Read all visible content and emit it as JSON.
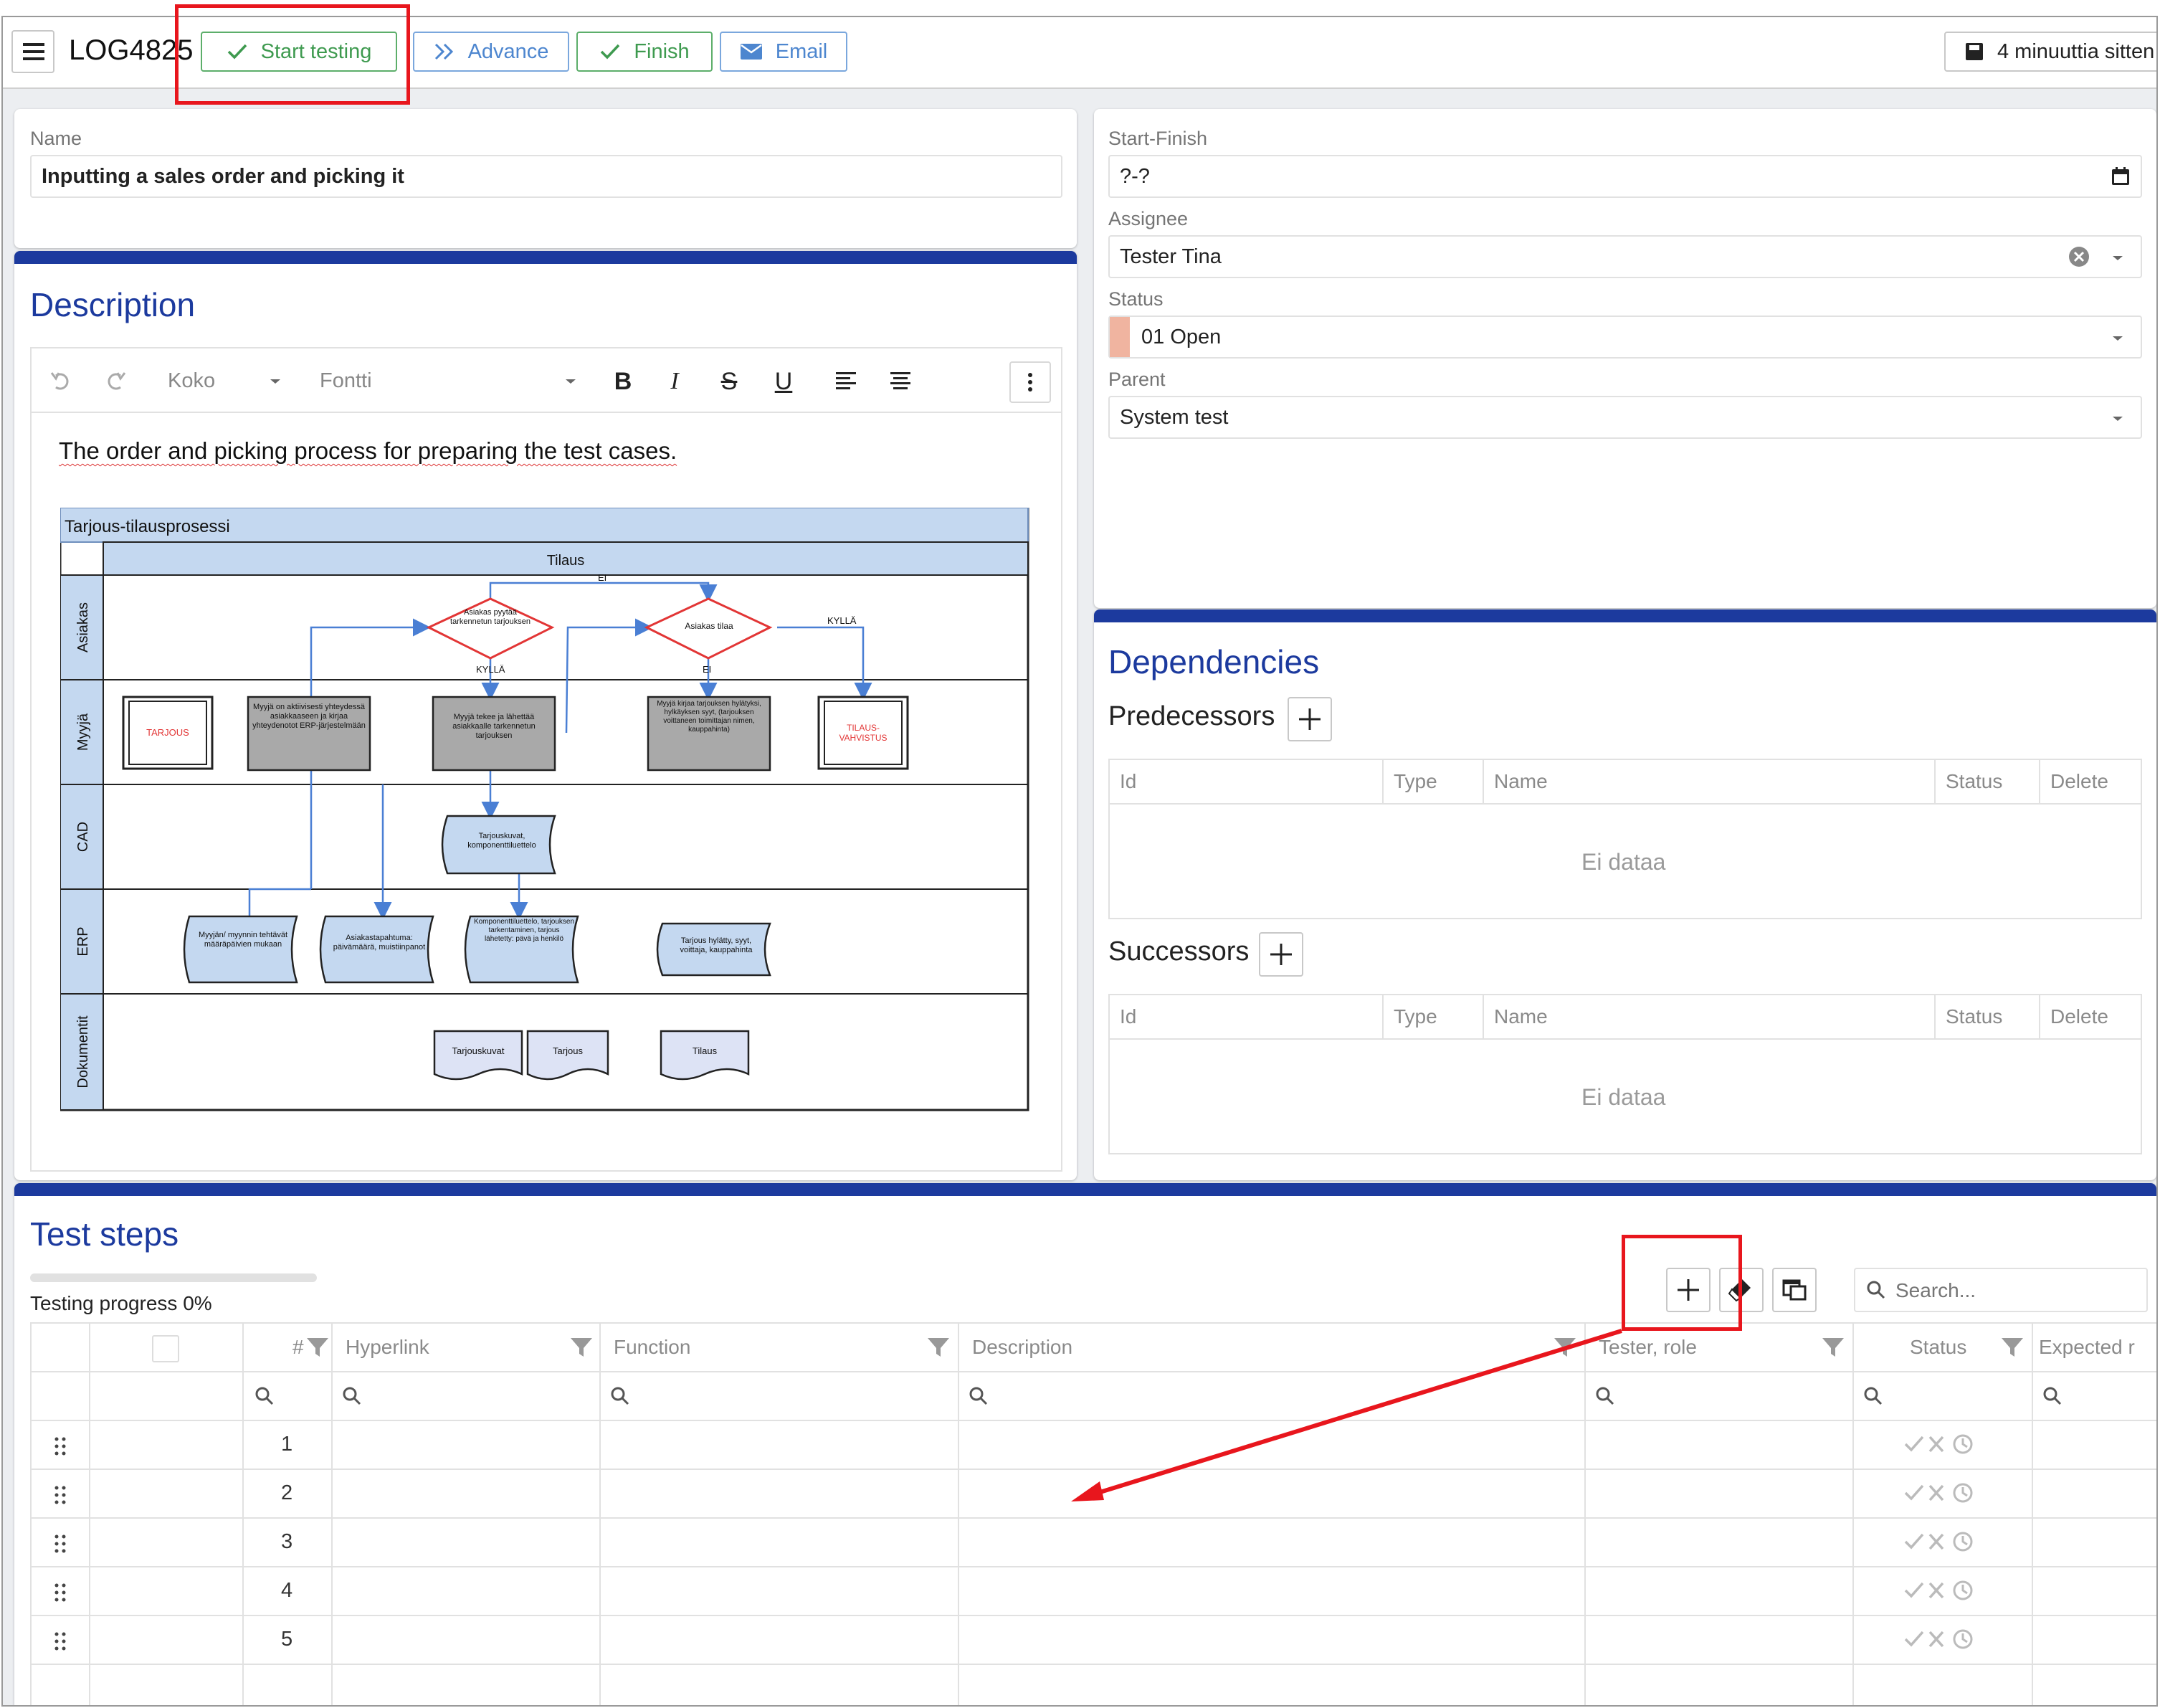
{
  "toolbar": {
    "record_id": "LOG4825",
    "start_label": "Start testing",
    "advance_label": "Advance",
    "finish_label": "Finish",
    "email_label": "Email",
    "saved_label": "4 minuuttia sitten"
  },
  "form": {
    "name_label": "Name",
    "name_value": "Inputting a sales order and picking it",
    "start_finish_label": "Start-Finish",
    "start_finish_value": "?-?",
    "assignee_label": "Assignee",
    "assignee_value": "Tester Tina",
    "status_label": "Status",
    "status_value": "01 Open",
    "status_color": "#f0b4a0",
    "parent_label": "Parent",
    "parent_value": "System test"
  },
  "description": {
    "title": "Description",
    "editor": {
      "size_label": "Koko",
      "font_label": "Fontti",
      "text": "The order and picking process for preparing the test cases."
    },
    "diagram": {
      "title": "Tarjous-tilausprosessi",
      "column": "Tilaus",
      "lanes": [
        "Asiakas",
        "Myyjä",
        "CAD",
        "ERP",
        "Dokumentit"
      ],
      "decisions": [
        "Asiakas pyytää tarkennetun tarjouksen",
        "Asiakas tilaa"
      ],
      "edge_labels": {
        "ei_top": "EI",
        "kylla_right": "KYLLÄ",
        "kylla_mid": "KYLLÄ",
        "ei_mid": "EI"
      },
      "seller_boxes": [
        "TARJOUS",
        "Myyjä on aktiivisesti yhteydessä asiakkaaseen ja kirjaa yhteydenotot ERP-järjestelmään",
        "Myyjä tekee ja lähettää asiakkaalle tarkennetun tarjouksen",
        "Myyjä kirjaa tarjouksen hylätyksi, hylkäyksen syyt, (tarjouksen voittaneen toimittajan nimen, kauppahinta)",
        "TILAUS-VAHVISTUS"
      ],
      "cad_box": "Tarjouskuvat, komponenttiluettelo",
      "erp_boxes": [
        "Myyjän/ myynnin tehtävät määräpäivien mukaan",
        "Asiakastapahtuma: päivämäärä, muistiinpanot",
        "Komponenttiluettelo, tarjouksen tarkentaminen, tarjous lähetetty: pävä ja henkilö",
        "Tarjous hylätty, syyt, voittaja, kauppahinta"
      ],
      "docs": [
        "Tarjouskuvat",
        "Tarjous",
        "Tilaus"
      ]
    }
  },
  "dependencies": {
    "title": "Dependencies",
    "predecessors_title": "Predecessors",
    "successors_title": "Successors",
    "columns": [
      "Id",
      "Type",
      "Name",
      "Status",
      "Delete"
    ],
    "empty_text": "Ei dataa"
  },
  "test_steps": {
    "title": "Test steps",
    "progress_label": "Testing progress 0%",
    "progress": 0,
    "search_placeholder": "Search...",
    "columns": [
      "#",
      "Hyperlink",
      "Function",
      "Description",
      "Tester, role",
      "Status",
      "Expected r"
    ],
    "rows": [
      "1",
      "2",
      "3",
      "4",
      "5"
    ]
  },
  "colors": {
    "accent": "#1c3a9e",
    "green": "#3e9a4f",
    "blue": "#4d86cf",
    "annotation": "#e8161d"
  }
}
